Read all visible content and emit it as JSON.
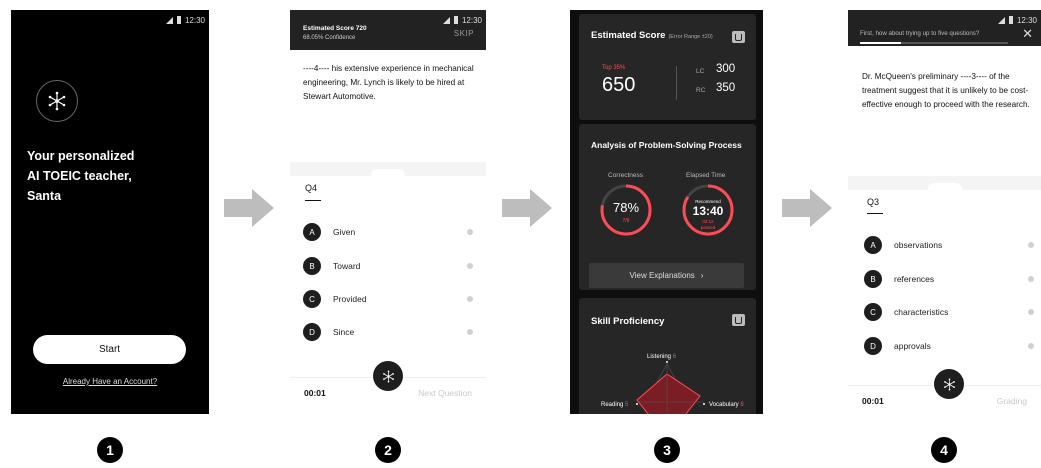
{
  "colors": {
    "accent_red": "#ff4b55",
    "dark_bg": "#000000",
    "card_bg": "#262626"
  },
  "screen1": {
    "status_time": "12:30",
    "logo_icon": "snowflake-icon",
    "title": "Your personalized\nAI TOEIC teacher,\nSanta",
    "start_label": "Start",
    "account_link": "Already Have an Account?"
  },
  "screen2": {
    "status_time": "12:30",
    "estimated_score": "Estimated Score 720",
    "confidence": "68.05% Confidence",
    "skip_label": "SKIP",
    "question_text": "----4---- his extensive experience in mechanical engineering, Mr. Lynch is likely to be hired at Stewart Automotive.",
    "question_number": "Q4",
    "options": [
      {
        "letter": "A",
        "text": "Given"
      },
      {
        "letter": "B",
        "text": "Toward"
      },
      {
        "letter": "C",
        "text": "Provided"
      },
      {
        "letter": "D",
        "text": "Since"
      }
    ],
    "timer": "00:01",
    "next_label": "Next Question"
  },
  "screen3": {
    "score_card": {
      "title": "Estimated Score",
      "subtitle": "(Error Range ±20)",
      "top_percent": "Top 35%",
      "total": "650",
      "lc_label": "LC",
      "lc_value": "300",
      "rc_label": "RC",
      "rc_value": "350"
    },
    "analysis_card": {
      "title": "Analysis of Problem-Solving Process",
      "correctness_label": "Correctness",
      "correctness_value": "78%",
      "correctness_fraction": "7/9",
      "correctness_ratio": 0.78,
      "elapsed_label": "Elapsed Time",
      "recommend_label": "Recommend",
      "recommend_time": "13:40",
      "passed_time": "02:12",
      "passed_label": "passed",
      "elapsed_ratio": 0.84,
      "view_button": "View Explanations"
    },
    "skill_card": {
      "title": "Skill Proficiency",
      "skills": [
        {
          "name": "Listening",
          "value": "6"
        },
        {
          "name": "Reading",
          "value": "5"
        },
        {
          "name": "Vocabulary",
          "value": "8"
        }
      ]
    }
  },
  "screen4": {
    "status_time": "12:30",
    "prompt": "First, how about trying up to five questions?",
    "progress_ratio": 0.28,
    "question_text": "Dr. McQueen's preliminary ----3---- of the treatment suggest that it is unlikely to be cost-effective enough to proceed with the research.",
    "question_number": "Q3",
    "options": [
      {
        "letter": "A",
        "text": "observations"
      },
      {
        "letter": "B",
        "text": "references"
      },
      {
        "letter": "C",
        "text": "characteristics"
      },
      {
        "letter": "D",
        "text": "approvals"
      }
    ],
    "timer": "00:01",
    "grading_label": "Grading"
  },
  "step_numbers": [
    "1",
    "2",
    "3",
    "4"
  ]
}
